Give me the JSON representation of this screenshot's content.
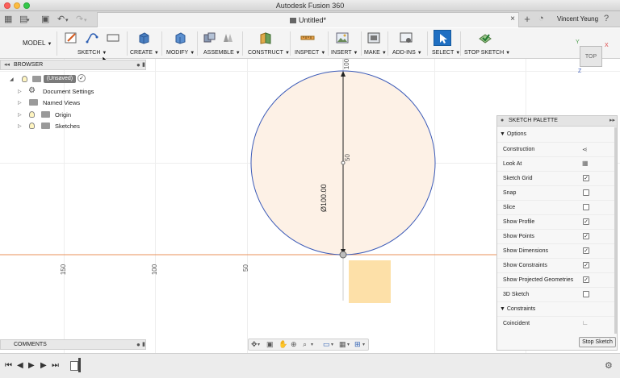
{
  "window": {
    "title": "Autodesk Fusion 360"
  },
  "tabbar": {
    "doc_tab": "Untitled*",
    "close": "×",
    "new_tab": "+",
    "user": "Vincent Yeung"
  },
  "toolbar": {
    "workspace": "MODEL",
    "groups": [
      {
        "label": "SKETCH"
      },
      {
        "label": "CREATE"
      },
      {
        "label": "MODIFY"
      },
      {
        "label": "ASSEMBLE"
      },
      {
        "label": "CONSTRUCT"
      },
      {
        "label": "INSPECT"
      },
      {
        "label": "INSERT"
      },
      {
        "label": "MAKE"
      },
      {
        "label": "ADD-INS"
      },
      {
        "label": "SELECT"
      },
      {
        "label": "STOP SKETCH"
      }
    ]
  },
  "browser": {
    "title": "BROWSER",
    "root": "(Unsaved)",
    "items": [
      {
        "label": "Document Settings",
        "icon": "gear-icon"
      },
      {
        "label": "Named Views",
        "icon": "folder-icon"
      },
      {
        "label": "Origin",
        "icon": "folder-icon"
      },
      {
        "label": "Sketches",
        "icon": "folder-icon"
      }
    ]
  },
  "comments": {
    "title": "COMMENTS"
  },
  "viewcube": {
    "face": "TOP",
    "axis_x": "X",
    "axis_y": "Y",
    "axis_z": "Z"
  },
  "canvas": {
    "dimension": "Ø100.00",
    "axis_labels": {
      "h150": "150",
      "h100": "100",
      "h50": "50",
      "v100": "100",
      "v50": "50"
    },
    "accent_circle": "#3c5bb8",
    "fill_circle": "#fdf1e6",
    "fill_square": "#fde0a8"
  },
  "palette": {
    "title": "SKETCH PALETTE",
    "options_label": "Options",
    "options": [
      {
        "label": "Construction",
        "kind": "icon"
      },
      {
        "label": "Look At",
        "kind": "icon"
      },
      {
        "label": "Sketch Grid",
        "checked": true
      },
      {
        "label": "Snap",
        "checked": false
      },
      {
        "label": "Slice",
        "checked": false
      },
      {
        "label": "Show Profile",
        "checked": true
      },
      {
        "label": "Show Points",
        "checked": true
      },
      {
        "label": "Show Dimensions",
        "checked": true
      },
      {
        "label": "Show Constraints",
        "checked": true
      },
      {
        "label": "Show Projected Geometries",
        "checked": true
      },
      {
        "label": "3D Sketch",
        "checked": false
      }
    ],
    "constraints_label": "Constraints",
    "constraints": [
      {
        "label": "Coincident"
      }
    ],
    "stop_button": "Stop Sketch"
  }
}
